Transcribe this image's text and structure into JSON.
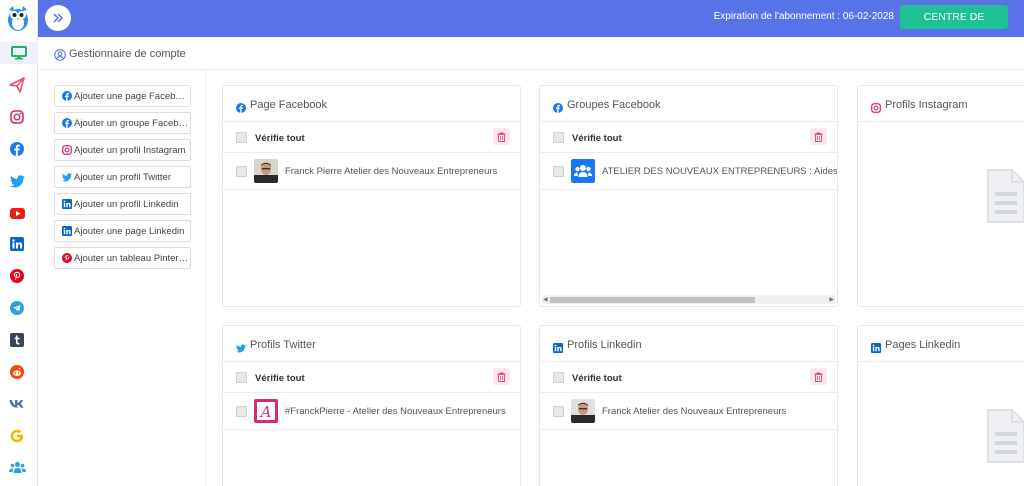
{
  "topbar": {
    "expiry_text": "Expiration de l'abonnement : 06-02-2028",
    "support_label": "CENTRE DE SOUTIEN"
  },
  "page": {
    "title": "Gestionnaire de compte"
  },
  "sidebar_icons": [
    "monitor-icon",
    "send-icon",
    "instagram-icon",
    "facebook-icon",
    "twitter-icon",
    "youtube-icon",
    "linkedin-icon",
    "pinterest-icon",
    "telegram-icon",
    "tumblr-icon",
    "reddit-icon",
    "vk-icon",
    "google-icon",
    "users-icon"
  ],
  "add_buttons": [
    {
      "label": "Ajouter une page Facebook",
      "icon": "facebook-icon"
    },
    {
      "label": "Ajouter un groupe Facebook",
      "icon": "facebook-icon"
    },
    {
      "label": "Ajouter un profil Instagram",
      "icon": "instagram-icon"
    },
    {
      "label": "Ajouter un profil Twitter",
      "icon": "twitter-icon"
    },
    {
      "label": "Ajouter un profil Linkedin",
      "icon": "linkedin-icon"
    },
    {
      "label": "Ajouter une page Linkedin",
      "icon": "linkedin-icon"
    },
    {
      "label": "Ajouter un tableau Pinterest",
      "icon": "pinterest-icon"
    }
  ],
  "cards": {
    "check_all_label": "Vérifie tout",
    "page_facebook": {
      "title": "Page Facebook",
      "item": "Franck Pierre Atelier des Nouveaux Entrepreneurs"
    },
    "groupes_facebook": {
      "title": "Groupes Facebook",
      "item": "ATELIER DES NOUVEAUX ENTREPRENEURS : Aides Auto-entrepreneurs"
    },
    "profils_instagram": {
      "title": "Profils Instagram"
    },
    "profils_twitter": {
      "title": "Profils Twitter",
      "item": "#FranckPierre - Atelier des Nouveaux Entrepreneurs"
    },
    "profils_linkedin": {
      "title": "Profils Linkedin",
      "item": "Franck Atelier des Nouveaux Entrepreneurs"
    },
    "pages_linkedin": {
      "title": "Pages Linkedin"
    }
  },
  "colors": {
    "topbar": "#5872e8",
    "support_button": "#1ec193",
    "facebook": "#1877f2",
    "instagram": "#d62976",
    "twitter": "#1da1f2",
    "linkedin": "#0a66c2",
    "pinterest": "#e60023",
    "trash": "#e8506f"
  }
}
